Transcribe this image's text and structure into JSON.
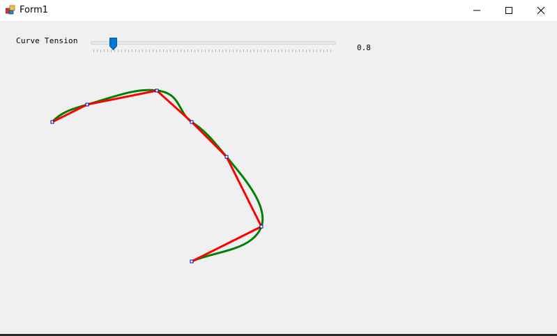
{
  "window": {
    "title": "Form1"
  },
  "controls": {
    "label": "Curve Tension",
    "value_text": "0.8",
    "slider_value": 0.8
  },
  "curve": {
    "colors": {
      "curve": "#008000",
      "polyline": "#ff0000",
      "handle_fill": "#ffffff",
      "handle_stroke": "#0000a0"
    }
  },
  "icons": {
    "minimize": "minimize-icon",
    "maximize": "maximize-icon",
    "close": "close-icon",
    "app": "app-icon"
  }
}
